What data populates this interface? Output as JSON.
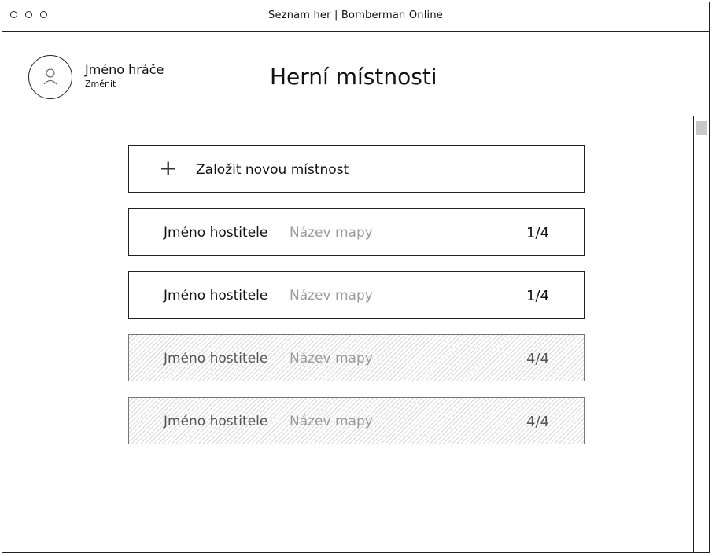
{
  "window": {
    "title": "Seznam her | Bomberman Online"
  },
  "header": {
    "player_name": "Jméno hráče",
    "change_label": "Změnit",
    "page_title": "Herní místnosti"
  },
  "create_room": {
    "label": "Založit novou místnost",
    "icon": "plus-icon"
  },
  "rooms": [
    {
      "host": "Jméno hostitele",
      "map": "Název mapy",
      "players": "1/4",
      "full": false
    },
    {
      "host": "Jméno hostitele",
      "map": "Název mapy",
      "players": "1/4",
      "full": false
    },
    {
      "host": "Jméno hostitele",
      "map": "Název mapy",
      "players": "4/4",
      "full": true
    },
    {
      "host": "Jméno hostitele",
      "map": "Název mapy",
      "players": "4/4",
      "full": true
    }
  ]
}
